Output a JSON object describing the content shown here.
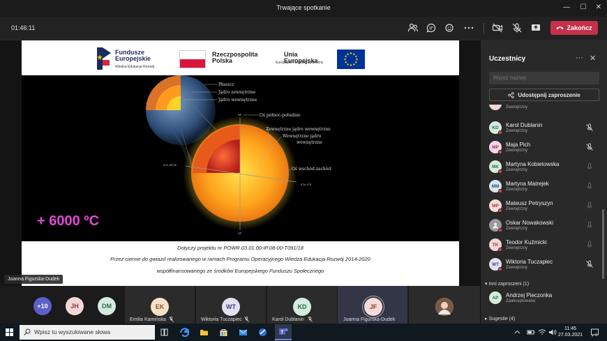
{
  "window": {
    "title": "Trwające spotkanie"
  },
  "meeting": {
    "timer": "01:46:11",
    "end_label": "Zakończ"
  },
  "slide": {
    "fe_title": "Fundusze\nEuropejskie",
    "fe_sub": "Wiedza Edukacja Rozwój",
    "rp_title": "Rzeczpospolita\nPolska",
    "ue_title": "Unia Europejska",
    "ue_sub": "Europejski Fundusz Społeczny",
    "diagram": {
      "plaszcz": "Płaszcz",
      "jadro_zew": "Jądro zewnętrzne",
      "jadro_wew": "Jądro wewnętrzne",
      "os_pn": "Oś północ-południe",
      "zew_jadro": "Zewnętrzne jądro wewnętrzne",
      "wew_jadro": "Wewnętrzne jądro\nwewnętrzne",
      "os_ew": "Oś wschód-zachód",
      "np": "NP",
      "sp": "SP",
      "w_coord": "0°N, 90°W",
      "e_coord": "0°N, 0°E"
    },
    "temperature": "+ 6000 ºC",
    "caption1": "Dotyczy projektu nr POWR.03.01.00-IP.08-00-T091/18",
    "caption2": "Przez ciernie do gwiazd realizowanego w ramach Programu Operacyjnego Wiedza Edukacja Rozwój 2014-2020",
    "caption3": "współfinansowanego ze środków Europejskiego Funduszu Społecznego"
  },
  "presenter_chip": "Joanna Figurska-Dudek",
  "gallery": [
    {
      "initials": "+10",
      "name": "",
      "color": "#5b5fc7",
      "text": "#fff"
    },
    {
      "initials": "JH",
      "name": "",
      "color": "#f3d6d6",
      "text": "#8a3b3b"
    },
    {
      "initials": "DM",
      "name": "",
      "color": "#d6ebdf",
      "text": "#2f6b4a"
    },
    {
      "initials": "EK",
      "name": "Emilia Kamińska",
      "color": "#f6e0c8",
      "text": "#8a5a2a"
    },
    {
      "initials": "WT",
      "name": "Wiktoria Tuczapiec",
      "color": "#e1e1f2",
      "text": "#44447a"
    },
    {
      "initials": "KD",
      "name": "Karol Dublanin",
      "color": "#d6ebdf",
      "text": "#2f6b4a"
    },
    {
      "initials": "JF",
      "name": "Joanna Figurska-Dudek",
      "color": "#f6dcd8",
      "text": "#9b3a2e"
    }
  ],
  "participants_panel": {
    "title": "Uczestnicy",
    "search_placeholder": "Wpisz nazwę",
    "share_label": "Udostępnij zaproszenie",
    "rows": [
      {
        "initials": "",
        "name": "",
        "status": "Zewnętrzny",
        "color": "#f3d6d6",
        "text": "#8a3b3b",
        "muted": false
      },
      {
        "initials": "KD",
        "name": "Karol Dublanin",
        "status": "Zewnętrzny",
        "color": "#d6ebdf",
        "text": "#2f6b4a",
        "muted": true
      },
      {
        "initials": "MP",
        "name": "Maja Pich",
        "status": "Zewnętrzny",
        "color": "#f5d6e6",
        "text": "#8a3b64",
        "muted": true
      },
      {
        "initials": "MK",
        "name": "Martyna Kobietowska",
        "status": "Zewnętrzny",
        "color": "#d6ebdf",
        "text": "#2f6b4a",
        "muted": false
      },
      {
        "initials": "MM",
        "name": "Martyna Matrejek",
        "status": "Zewnętrzny",
        "color": "#d8e6f0",
        "text": "#2f4f6b",
        "muted": false
      },
      {
        "initials": "MP",
        "name": "Mateusz Petryszyn",
        "status": "Zewnętrzny",
        "color": "#f6dcd8",
        "text": "#9b3a2e",
        "muted": false
      },
      {
        "initials": "ON",
        "name": "Oskar Nowakowski",
        "status": "Zewnętrzny",
        "color": "#9a9a9a",
        "text": "#fff",
        "muted": false
      },
      {
        "initials": "TK",
        "name": "Teodor Kuźmicki",
        "status": "Zewnętrzny",
        "color": "#f3d6d6",
        "text": "#8a3b3b",
        "muted": false
      },
      {
        "initials": "WT",
        "name": "Wiktoria Tuczapiec",
        "status": "Zewnętrzny",
        "color": "#e1e1f2",
        "text": "#44447a",
        "muted": true
      }
    ],
    "invited_section": "Inni zaproszeni (1)",
    "invited": {
      "initials": "AP",
      "name": "Andrzej Pieczonka",
      "status": "Zaakceptowane",
      "color": "#d6ebdf",
      "text": "#2f6b4a"
    },
    "suggestions_section": "Sugestie (4)"
  },
  "taskbar": {
    "search_placeholder": "Wpisz tu wyszukiwane słowa",
    "time": "11:45",
    "date": "27.03.2021"
  },
  "colors": {
    "accent": "#5b5fc7",
    "end_red": "#c4314b",
    "temp_magenta": "#e04ad6"
  }
}
